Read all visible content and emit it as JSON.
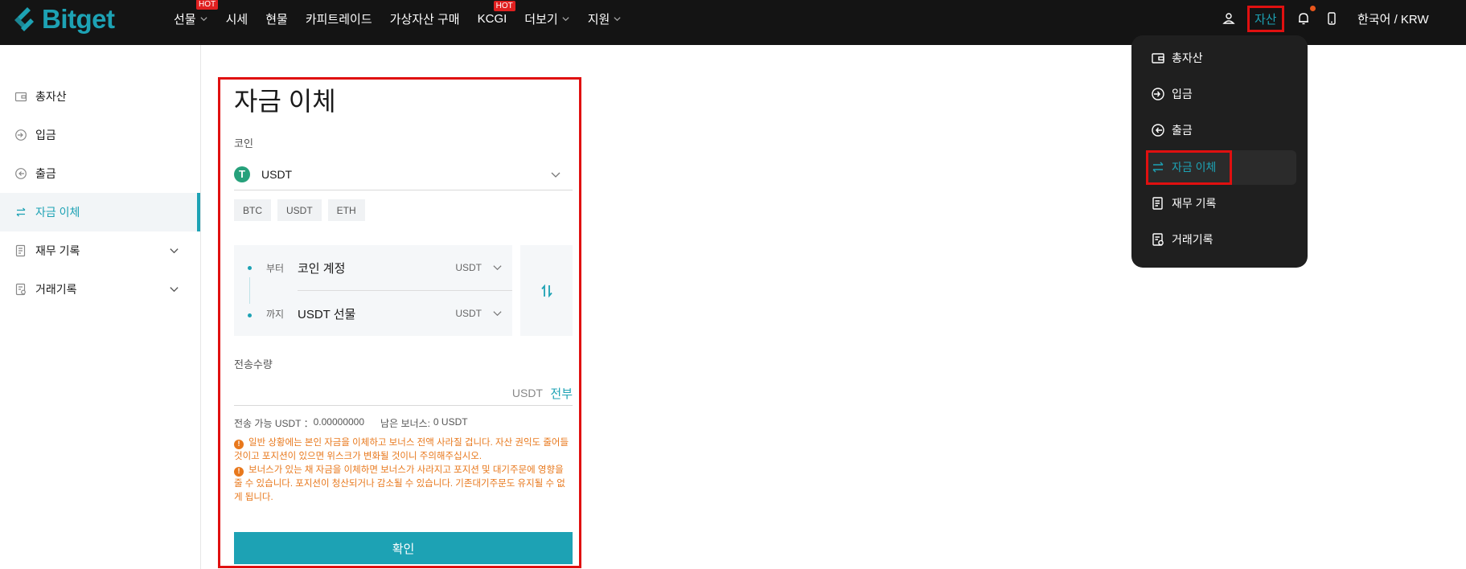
{
  "brand": {
    "name": "Bitget",
    "accent": "#1da2b4",
    "warning": "#e8781c",
    "highlight": "#e01010"
  },
  "nav": {
    "items": [
      {
        "label": "선물",
        "hot": "HOT",
        "dropdown": true
      },
      {
        "label": "시세"
      },
      {
        "label": "현물"
      },
      {
        "label": "카피트레이드"
      },
      {
        "label": "가상자산 구매"
      },
      {
        "label": "KCGI",
        "hot": "HOT"
      },
      {
        "label": "더보기",
        "dropdown": true
      },
      {
        "label": "지원",
        "dropdown": true
      }
    ],
    "assets": "자산",
    "language": "한국어 / KRW",
    "icons": [
      "user-icon",
      "bell-icon",
      "phone-icon"
    ]
  },
  "asset_menu": {
    "items": [
      {
        "label": "총자산",
        "icon": "wallet-icon"
      },
      {
        "label": "입금",
        "icon": "deposit-icon"
      },
      {
        "label": "출금",
        "icon": "withdraw-icon"
      },
      {
        "label": "자금 이체",
        "icon": "transfer-icon",
        "active": true
      },
      {
        "label": "재무 기록",
        "icon": "record-icon"
      },
      {
        "label": "거래기록",
        "icon": "trade-record-icon"
      }
    ]
  },
  "sidebar": {
    "items": [
      {
        "label": "총자산",
        "icon": "wallet-icon"
      },
      {
        "label": "입금",
        "icon": "deposit-icon"
      },
      {
        "label": "출금",
        "icon": "withdraw-icon"
      },
      {
        "label": "자금 이체",
        "icon": "transfer-icon",
        "active": true
      },
      {
        "label": "재무 기록",
        "icon": "record-icon",
        "expandable": true
      },
      {
        "label": "거래기록",
        "icon": "trade-record-icon",
        "expandable": true
      }
    ]
  },
  "transfer": {
    "title": "자금 이체",
    "coin_label": "코인",
    "coin": "USDT",
    "coin_icon": "tether-icon",
    "quick_coins": [
      "BTC",
      "USDT",
      "ETH"
    ],
    "from": {
      "direction": "부터",
      "account": "코인 계정",
      "currency": "USDT"
    },
    "to": {
      "direction": "까지",
      "account": "USDT 선물",
      "currency": "USDT"
    },
    "amount_label": "전송수량",
    "amount_value": "",
    "amount_unit": "USDT",
    "all_label": "전부",
    "available_label": "전송 가능 USDT ：",
    "available_value": "0.00000000",
    "bonus_label": "남은 보너스:",
    "bonus_value": "0 USDT",
    "warnings": [
      "일반 상황에는 본인 자금을 이체하고 보너스 전액 사라질 겁니다. 자산 권익도 줄어들 것이고 포지션이 있으면 위스크가 변화될 것이니 주의해주십시오.",
      "보너스가 있는 채 자금을 이체하면 보너스가 사라지고 포지션 및 대기주문에 영향을 줄 수 있습니다. 포지션이 청산되거나 감소될 수 있습니다. 기존대기주문도 유지될 수 없게 됩니다."
    ],
    "confirm": "확인"
  }
}
